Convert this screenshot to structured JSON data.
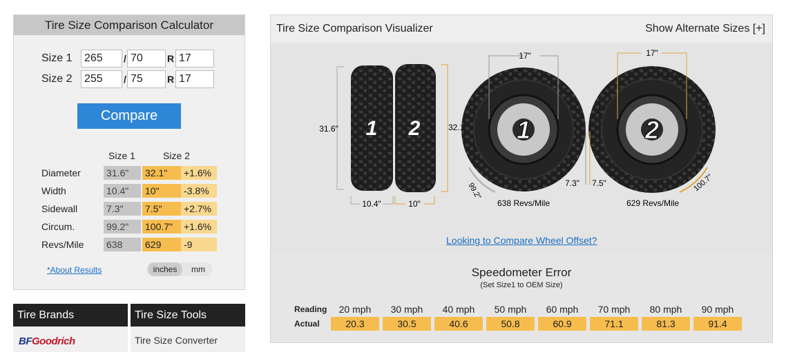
{
  "calculator": {
    "title": "Tire Size Comparison Calculator",
    "size1": {
      "label": "Size 1",
      "width": "265",
      "ratio": "70",
      "rim": "17"
    },
    "size2": {
      "label": "Size 2",
      "width": "255",
      "ratio": "75",
      "rim": "17"
    },
    "slash": "/",
    "r_label": "R",
    "compare_label": "Compare",
    "col_size1": "Size 1",
    "col_size2": "Size 2",
    "rows": [
      {
        "label": "Diameter",
        "s1": "31.6\"",
        "s2": "32.1\"",
        "diff": "+1.6%"
      },
      {
        "label": "Width",
        "s1": "10.4\"",
        "s2": "10\"",
        "diff": "-3.8%"
      },
      {
        "label": "Sidewall",
        "s1": "7.3\"",
        "s2": "7.5\"",
        "diff": "+2.7%"
      },
      {
        "label": "Circum.",
        "s1": "99.2\"",
        "s2": "100.7\"",
        "diff": "+1.6%"
      },
      {
        "label": "Revs/Mile",
        "s1": "638",
        "s2": "629",
        "diff": "-9"
      }
    ],
    "about_link": "*About Results",
    "unit_inches": "inches",
    "unit_mm": "mm"
  },
  "bottom": {
    "brands_title": "Tire Brands",
    "brand_logo_a": "BF",
    "brand_logo_b": "Goodrich",
    "tools_title": "Tire Size Tools",
    "tools_item": "Tire Size Converter"
  },
  "visualizer": {
    "title": "Tire Size Comparison Visualizer",
    "alt_sizes": "Show Alternate Sizes [+]",
    "tire1_num": "1",
    "tire2_num": "2",
    "dia1": "31.6\"",
    "dia2": "32.1\"",
    "width1": "10.4\"",
    "width2": "10\"",
    "rim1": "17\"",
    "rim2": "17\"",
    "side1": "7.3\"",
    "side2": "7.5\"",
    "circ1": "99.2\"",
    "circ2": "100.7\"",
    "revs1": "638 Revs/Mile",
    "revs2": "629 Revs/Mile",
    "offset_link": "Looking to Compare Wheel Offset?"
  },
  "speedometer": {
    "title": "Speedometer Error",
    "subtitle": "(Set Size1 to OEM Size)",
    "reading_label": "Reading",
    "actual_label": "Actual",
    "readings": [
      "20 mph",
      "30 mph",
      "40 mph",
      "50 mph",
      "60 mph",
      "70 mph",
      "80 mph",
      "90 mph"
    ],
    "actuals": [
      "20.3",
      "30.5",
      "40.6",
      "50.8",
      "60.9",
      "71.1",
      "81.3",
      "91.4"
    ]
  },
  "colors": {
    "accent": "#2f86d6",
    "highlight": "#f6bd4e",
    "dim_line": "#e0a53a"
  }
}
